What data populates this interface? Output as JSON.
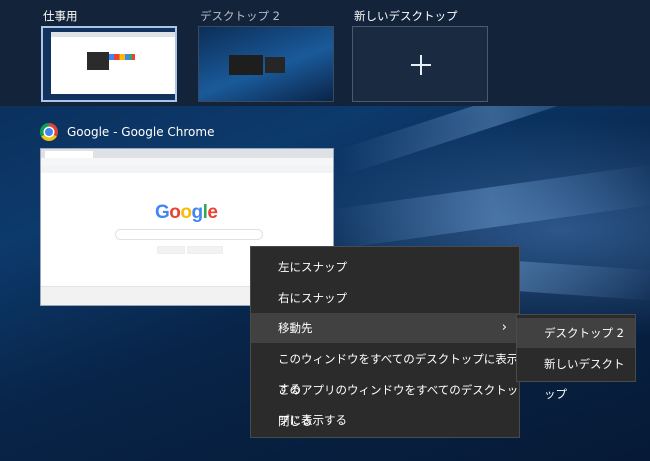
{
  "desktops": [
    {
      "label": "仕事用",
      "selected": true
    },
    {
      "label": "デスクトップ 2",
      "selected": false
    },
    {
      "label": "新しいデスクトップ",
      "selected": false
    }
  ],
  "window": {
    "title": "Google - Google Chrome",
    "icon": "chrome-logo-icon",
    "preview_logo": "Google"
  },
  "context_menu": {
    "items": [
      {
        "label": "左にスナップ"
      },
      {
        "label": "右にスナップ"
      },
      {
        "label": "移動先",
        "has_submenu": true,
        "chevron": "›"
      },
      {
        "label": "このウィンドウをすべてのデスクトップに表示する"
      },
      {
        "label": "このアプリのウィンドウをすべてのデスクトップに表示する"
      },
      {
        "label": "閉じる"
      }
    ]
  },
  "submenu": {
    "items": [
      {
        "label": "デスクトップ 2"
      },
      {
        "label": "新しいデスクトップ"
      }
    ]
  },
  "colors": {
    "topbar": "#13233a",
    "menu_bg": "#2b2b2b",
    "menu_hover": "#414141",
    "selected_border": "#a9c6ea"
  }
}
